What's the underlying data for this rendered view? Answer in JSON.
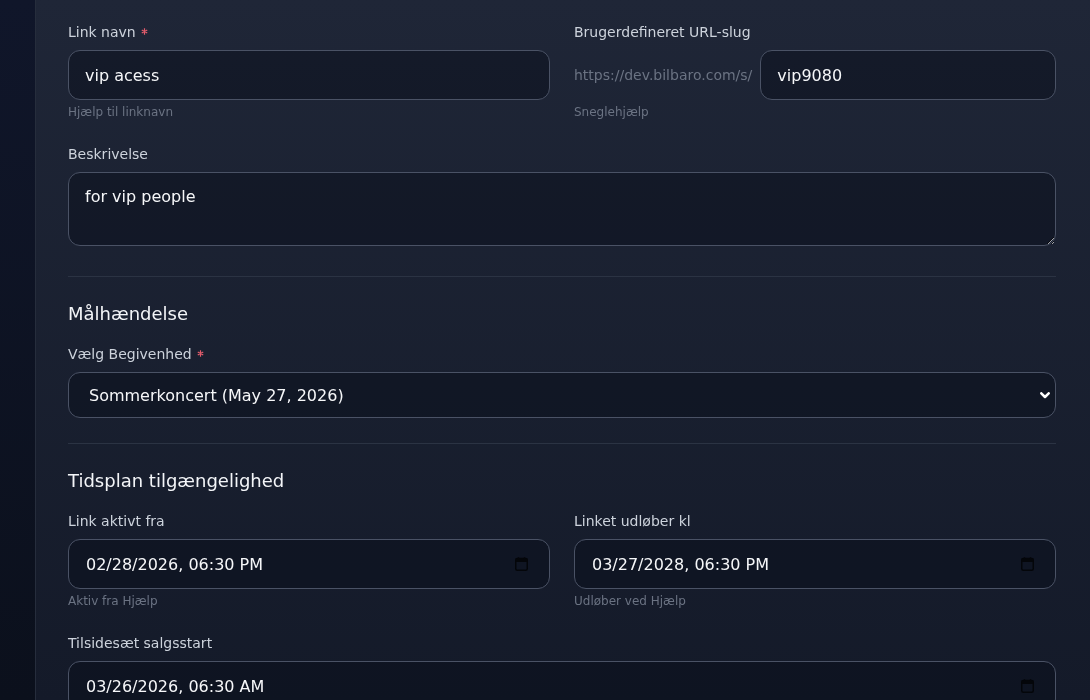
{
  "sections": [
    {
      "rows": [
        [
          {
            "kind": "text",
            "label": "Link navn",
            "required": true,
            "value": "vip acess",
            "help": "Hjælp til linknavn"
          },
          {
            "kind": "slug",
            "label": "Brugerdefineret URL-slug",
            "required": false,
            "prefix": "https://dev.bilbaro.com/s/",
            "value": "vip9080",
            "help": "Sneglehjælp"
          }
        ],
        [
          {
            "kind": "textarea",
            "label": "Beskrivelse",
            "required": false,
            "value": "for vip people"
          }
        ]
      ]
    },
    {
      "title": "Målhændelse",
      "rows": [
        [
          {
            "kind": "select",
            "label": "Vælg Begivenhed",
            "required": true,
            "value": "Sommerkoncert (May 27, 2026)"
          }
        ]
      ]
    },
    {
      "title": "Tidsplan tilgængelighed",
      "rows": [
        [
          {
            "kind": "datetime",
            "label": "Link aktivt fra",
            "required": false,
            "value": "02/28/2026, 06:30 PM",
            "help": "Aktiv fra Hjælp"
          },
          {
            "kind": "datetime",
            "label": "Linket udløber kl",
            "required": false,
            "value": "03/27/2028, 06:30 PM",
            "help": "Udløber ved Hjælp"
          }
        ],
        [
          {
            "kind": "datetime",
            "label": "Tilsidesæt salgsstart",
            "required": false,
            "value": "03/26/2026, 06:30 AM"
          }
        ]
      ]
    }
  ]
}
